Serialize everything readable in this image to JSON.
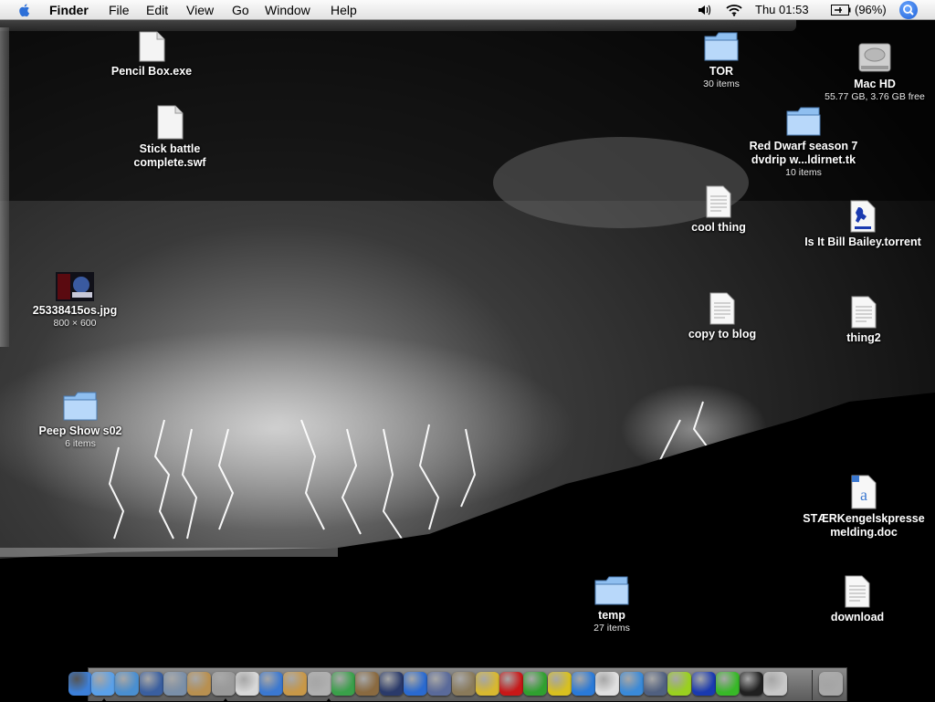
{
  "menubar": {
    "app_name": "Finder",
    "items": [
      "File",
      "Edit",
      "View",
      "Go",
      "Window",
      "Help"
    ],
    "clock": "Thu 01:53",
    "battery": "(96%)"
  },
  "desktop": {
    "icons": [
      {
        "label": "Pencil Box.exe",
        "sub": "",
        "kind": "document-icon"
      },
      {
        "label": "Stick battle complete.swf",
        "sub": "",
        "kind": "document-icon"
      },
      {
        "label": "25338415os.jpg",
        "sub": "800 × 600",
        "kind": "image-icon"
      },
      {
        "label": "Peep Show s02",
        "sub": "6 items",
        "kind": "folder-icon"
      },
      {
        "label": "TOR",
        "sub": "30 items",
        "kind": "folder-icon"
      },
      {
        "label": "Mac HD",
        "sub": "55.77 GB, 3.76 GB free",
        "kind": "hard-drive-icon"
      },
      {
        "label": "Red Dwarf season 7 dvdrip w...ldirnet.tk",
        "sub": "10 items",
        "kind": "folder-icon"
      },
      {
        "label": "cool thing",
        "sub": "",
        "kind": "text-file-icon"
      },
      {
        "label": "Is It Bill Bailey.torrent",
        "sub": "",
        "kind": "torrent-icon"
      },
      {
        "label": "copy to blog",
        "sub": "",
        "kind": "text-file-icon"
      },
      {
        "label": "thing2",
        "sub": "",
        "kind": "text-file-icon"
      },
      {
        "label": "STÆRKengelskpresse melding.doc",
        "sub": "",
        "kind": "word-doc-icon"
      },
      {
        "label": "temp",
        "sub": "27 items",
        "kind": "folder-icon"
      },
      {
        "label": "download",
        "sub": "",
        "kind": "text-file-icon"
      }
    ]
  },
  "dock": {
    "items": [
      {
        "name": "finder-icon",
        "color": "#3c7fd8"
      },
      {
        "name": "safari-icon",
        "color": "#5aa0e8"
      },
      {
        "name": "ichat-icon",
        "color": "#4a8fd0"
      },
      {
        "name": "preview-icon",
        "color": "#3a5fa0"
      },
      {
        "name": "iphoto-icon",
        "color": "#7a8fa8"
      },
      {
        "name": "utility-icon",
        "color": "#b89050"
      },
      {
        "name": "script-icon",
        "color": "#9a9a9a"
      },
      {
        "name": "textedit-icon",
        "color": "#d8d8d8"
      },
      {
        "name": "word-icon",
        "color": "#3b78d0"
      },
      {
        "name": "address-book-icon",
        "color": "#c89848"
      },
      {
        "name": "hard-disk-icon",
        "color": "#b0b0b0"
      },
      {
        "name": "itunes-icon",
        "color": "#3aa04a"
      },
      {
        "name": "idvd-icon",
        "color": "#8a6a40"
      },
      {
        "name": "imovie-icon",
        "color": "#2a3a6a"
      },
      {
        "name": "quicktime-icon",
        "color": "#2a6ad0"
      },
      {
        "name": "network-icon",
        "color": "#5a6a9a"
      },
      {
        "name": "xcode-icon",
        "color": "#8a7a5a"
      },
      {
        "name": "sketch-icon",
        "color": "#d8b830"
      },
      {
        "name": "flash-icon",
        "color": "#c81818"
      },
      {
        "name": "dreamweaver-icon",
        "color": "#30a030"
      },
      {
        "name": "fireworks-icon",
        "color": "#d8c020"
      },
      {
        "name": "flash-player-icon",
        "color": "#2a7ad8"
      },
      {
        "name": "ical-icon",
        "color": "#e0e0e0"
      },
      {
        "name": "mail-icon",
        "color": "#3a8ad8"
      },
      {
        "name": "system-prefs-icon",
        "color": "#506080"
      },
      {
        "name": "cyclorama-icon",
        "color": "#9ad020"
      },
      {
        "name": "azureus-icon",
        "color": "#1a3ab0"
      },
      {
        "name": "skype-icon",
        "color": "#38b828"
      },
      {
        "name": "terminal-icon",
        "color": "#202020"
      },
      {
        "name": "apple-app-icon",
        "color": "#c8c8c8"
      },
      {
        "name": "trash-icon",
        "color": "#a8a8a8"
      }
    ]
  }
}
